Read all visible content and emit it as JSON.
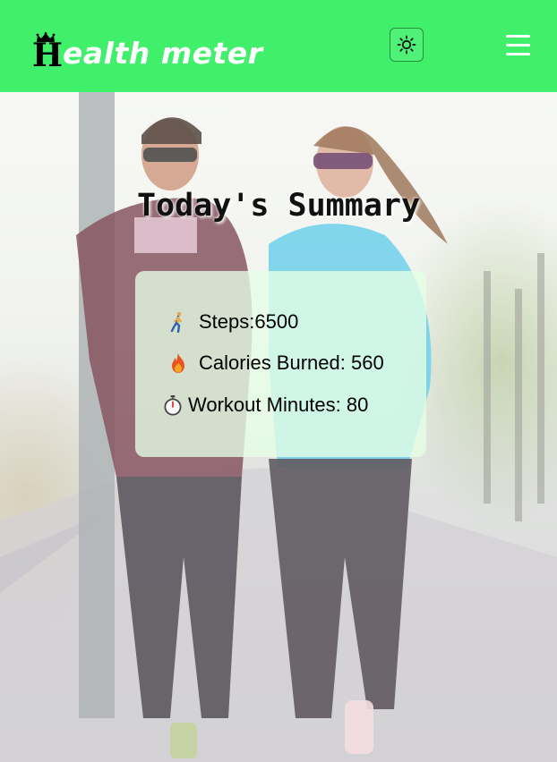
{
  "header": {
    "logo_initial": "H",
    "logo_rest": "ealth meter",
    "brand_color": "#40f06b",
    "theme_icon": "sun-icon",
    "menu_icon": "hamburger-menu-icon"
  },
  "summary": {
    "title": "Today's Summary",
    "stats": [
      {
        "icon": "walking-person-icon",
        "label": "Steps:6500"
      },
      {
        "icon": "fire-icon",
        "label": "Calories Burned: 560"
      },
      {
        "icon": "stopwatch-icon",
        "label": "Workout Minutes: 80"
      }
    ]
  }
}
